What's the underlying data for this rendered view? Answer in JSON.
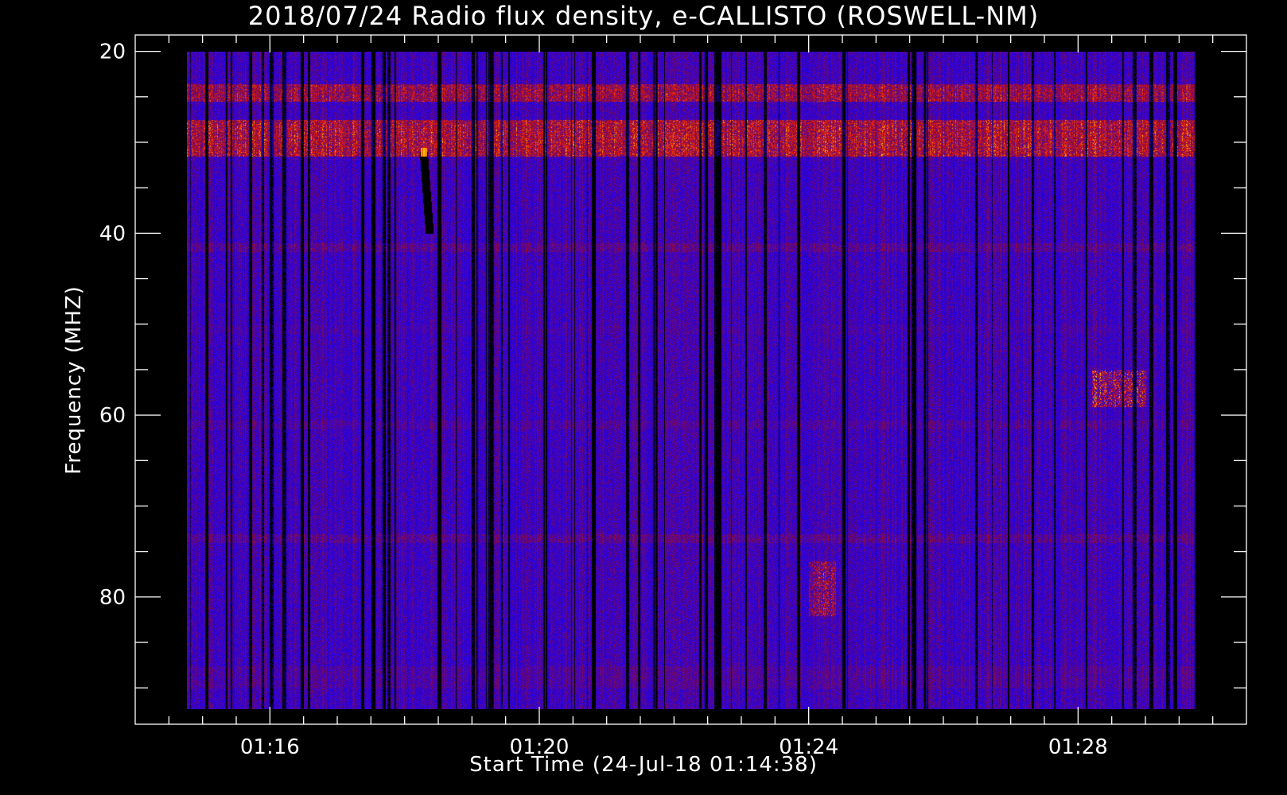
{
  "chart_data": {
    "type": "heatmap",
    "title": "2018/07/24  Radio flux density, e-CALLISTO (ROSWELL-NM)",
    "xlabel": "Start Time (24-Jul-18 01:14:38)",
    "ylabel": "Frequency (MHZ)",
    "x_tick_labels": [
      "01:16",
      "01:20",
      "01:24",
      "01:28"
    ],
    "x_ticks_minutes": [
      16,
      20,
      24,
      28
    ],
    "x_minor_step_minutes": 0.5,
    "xlim_minutes": [
      14.0,
      30.5
    ],
    "data_range_minutes": [
      14.77,
      29.73
    ],
    "y_tick_labels": [
      "20",
      "40",
      "60",
      "80"
    ],
    "y_ticks": [
      20,
      40,
      60,
      80
    ],
    "y_minor_step": 5,
    "ylim": [
      18.2,
      94.0
    ],
    "data_range_mhz": [
      20,
      92.3
    ],
    "y_axis_inverted": true,
    "colors": {
      "background": "#000000",
      "low": "#2200ee",
      "mid": "#8a0c3c",
      "high": "#ff2200",
      "peak": "#ffe000"
    },
    "features": [
      {
        "kind": "band",
        "f1": 23.5,
        "f2": 25.5,
        "intensity": 0.75
      },
      {
        "kind": "band",
        "f1": 27.5,
        "f2": 31.5,
        "intensity": 0.8
      },
      {
        "kind": "line",
        "f": 27.0,
        "intensity": 0.3
      },
      {
        "kind": "line",
        "f": 41.5,
        "intensity": 0.55
      },
      {
        "kind": "line",
        "f": 50.5,
        "intensity": 0.45
      },
      {
        "kind": "line",
        "f": 61.0,
        "intensity": 0.5
      },
      {
        "kind": "line",
        "f": 73.5,
        "intensity": 0.55
      },
      {
        "kind": "band",
        "f1": 87.5,
        "f2": 90.0,
        "intensity": 0.5
      },
      {
        "kind": "burst",
        "t": 18.28,
        "f1": 31,
        "f2": 40,
        "intensity": 0.95
      },
      {
        "kind": "patch",
        "t1": 28.2,
        "t2": 29.0,
        "f1": 55,
        "f2": 59,
        "intensity": 0.85
      },
      {
        "kind": "patch",
        "t1": 24.0,
        "t2": 24.4,
        "f1": 76,
        "f2": 82,
        "intensity": 0.75
      }
    ]
  }
}
